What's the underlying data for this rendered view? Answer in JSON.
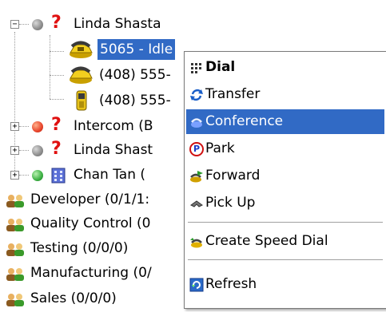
{
  "tree": {
    "items": [
      {
        "label": "Linda Shasta",
        "kind": "contact",
        "status": "offline"
      },
      {
        "label": "5065 - Idle",
        "kind": "phone"
      },
      {
        "label": "(408) 555-",
        "kind": "phone"
      },
      {
        "label": "(408) 555-",
        "kind": "mobile"
      },
      {
        "label": "Intercom (B",
        "kind": "contact",
        "status": "busy"
      },
      {
        "label": "Linda Shast",
        "kind": "contact",
        "status": "offline"
      },
      {
        "label": "Chan Tan (",
        "kind": "contact",
        "status": "available"
      }
    ],
    "groups": [
      {
        "label": "Developer  (0/1/1:"
      },
      {
        "label": "Quality Control  (0"
      },
      {
        "label": "Testing  (0/0/0)"
      },
      {
        "label": "Manufacturing  (0/"
      },
      {
        "label": "Sales  (0/0/0)"
      }
    ],
    "expand_collapsed": "+",
    "expand_open": "−",
    "question_mark": "?"
  },
  "context_menu": {
    "items": [
      {
        "label": "Dial",
        "icon": "dial-icon",
        "bold": true
      },
      {
        "label": "Transfer",
        "icon": "transfer-icon"
      },
      {
        "label": "Conference",
        "icon": "conference-icon",
        "highlighted": true
      },
      {
        "label": "Park",
        "icon": "park-icon"
      },
      {
        "label": "Forward",
        "icon": "forward-icon"
      },
      {
        "label": "Pick Up",
        "icon": "pickup-icon"
      },
      {
        "label": "Create Speed Dial",
        "icon": "speed-dial-icon"
      },
      {
        "label": "Refresh",
        "icon": "refresh-icon"
      }
    ],
    "park_icon_letter": "P"
  },
  "colors": {
    "selection": "#316ac5",
    "status_offline": "#8c8c8c",
    "status_busy": "#e8452c",
    "status_available": "#3cb043",
    "question": "#e01010"
  }
}
